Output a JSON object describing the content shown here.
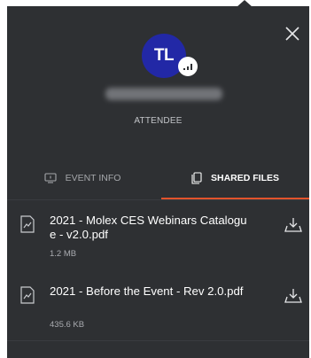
{
  "profile": {
    "initials": "TL",
    "role": "ATTENDEE"
  },
  "tabs": [
    {
      "label": "EVENT INFO",
      "active": false
    },
    {
      "label": "SHARED FILES",
      "active": true
    }
  ],
  "files": [
    {
      "name": "2021 - Molex CES Webinars Catalogue - v2.0.pdf",
      "size": "1.2 MB"
    },
    {
      "name": "2021 - Before the Event - Rev 2.0.pdf",
      "size": "435.6 KB"
    }
  ],
  "colors": {
    "panel_bg": "#2e3033",
    "avatar_bg": "#2228a6",
    "active_tab_underline": "#e2532c"
  },
  "icons": {
    "close": "close-icon",
    "event_info": "info-card-icon",
    "shared_files": "files-icon",
    "file": "document-chart-icon",
    "download": "download-icon",
    "signal": "signal-icon"
  }
}
